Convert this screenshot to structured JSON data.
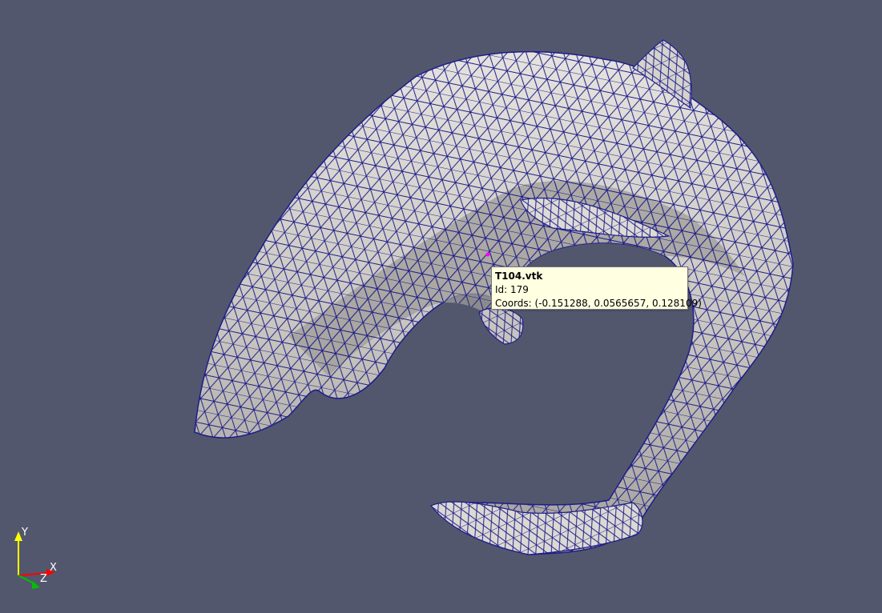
{
  "viewport": {
    "background_color": "#52576e",
    "mesh": {
      "surface_color": "#d9d6d0",
      "wire_color": "#1d1d8a",
      "picked_point_color": "#ff00ff"
    }
  },
  "tooltip": {
    "file_name": "T104.vtk",
    "id_label": "Id:",
    "id_value": "179",
    "coords_label": "Coords:",
    "coords_value": "(-0.151288, 0.0565657, 0.128109)"
  },
  "orientation_axes": {
    "y_label": "Y",
    "x_label": "X",
    "z_label": "Z",
    "y_color": "#ffff00",
    "x_color": "#ff0000",
    "z_color": "#00c000"
  }
}
